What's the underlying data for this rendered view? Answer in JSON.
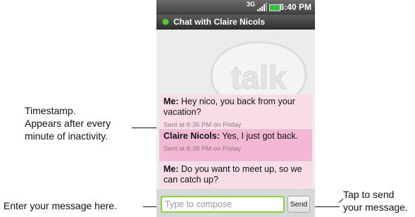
{
  "status_bar": {
    "network": "3G",
    "clock": "6:40 PM"
  },
  "title_bar": {
    "title": "Chat with Claire Nicols"
  },
  "background_logo": "talk",
  "messages": [
    {
      "sender": "Me:",
      "text": " Hey nico, you back from your vacation?",
      "time": "Sent at 6:36 PM on Friday"
    },
    {
      "sender": "Claire Nicols:",
      "text": " Yes, I just got back.",
      "time": "Sent at 6:38 PM on Friday"
    },
    {
      "sender": "Me:",
      "text": " Do you want to meet up, so we can catch up?",
      "time": ""
    }
  ],
  "compose": {
    "placeholder": "Type to compose",
    "send_label": "Send"
  },
  "callouts": {
    "timestamp": [
      "Timestamp.",
      "Appears after every",
      "minute of inactivity."
    ],
    "enter_message": "Enter your message here.",
    "tap_send": [
      "Tap to send",
      "your message."
    ]
  },
  "colors": {
    "presence": "#59c640",
    "incoming_highlight": "#f2b8d4",
    "message_bg": "#f8dce8",
    "input_border": "#8bd03f",
    "dot": "#1a3c8c"
  }
}
